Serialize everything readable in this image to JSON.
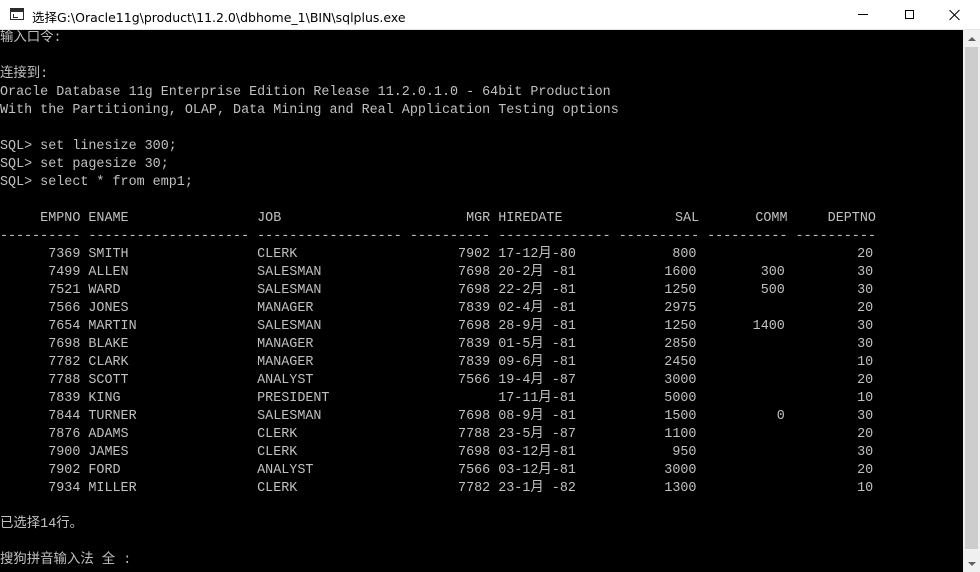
{
  "window": {
    "title": "选择G:\\Oracle11g\\product\\11.2.0\\dbhome_1\\BIN\\sqlplus.exe",
    "minimize_icon": "minimize-icon",
    "maximize_icon": "maximize-icon",
    "close_icon": "close-icon"
  },
  "console": {
    "password_prompt": "输入口令:",
    "connected_label": "连接到:",
    "banner_line1": "Oracle Database 11g Enterprise Edition Release 11.2.0.1.0 - 64bit Production",
    "banner_line2": "With the Partitioning, OLAP, Data Mining and Real Application Testing options",
    "commands": [
      "SQL> set linesize 300;",
      "SQL> set pagesize 30;",
      "SQL> select * from emp1;"
    ],
    "result_header": "     EMPNO ENAME                JOB                       MGR HIREDATE              SAL       COMM     DEPTNO",
    "result_separator": "---------- -------------------- ------------------ ---------- -------------- ---------- ---------- ----------",
    "rows": [
      "      7369 SMITH                CLERK                    7902 17-12月-80            800                    20",
      "      7499 ALLEN                SALESMAN                 7698 20-2月 -81           1600        300         30",
      "      7521 WARD                 SALESMAN                 7698 22-2月 -81           1250        500         30",
      "      7566 JONES                MANAGER                  7839 02-4月 -81           2975                    20",
      "      7654 MARTIN               SALESMAN                 7698 28-9月 -81           1250       1400         30",
      "      7698 BLAKE                MANAGER                  7839 01-5月 -81           2850                    30",
      "      7782 CLARK                MANAGER                  7839 09-6月 -81           2450                    10",
      "      7788 SCOTT                ANALYST                  7566 19-4月 -87           3000                    20",
      "      7839 KING                 PRESIDENT                     17-11月-81           5000                    10",
      "      7844 TURNER               SALESMAN                 7698 08-9月 -81           1500          0         30",
      "      7876 ADAMS                CLERK                    7788 23-5月 -87           1100                    20",
      "      7900 JAMES                CLERK                    7698 03-12月-81            950                    30",
      "      7902 FORD                 ANALYST                  7566 03-12月-81           3000                    20",
      "      7934 MILLER               CLERK                    7782 23-1月 -82           1300                    10"
    ],
    "rows_selected": "已选择14行。",
    "ime_status": "搜狗拼音输入法 全 :"
  }
}
